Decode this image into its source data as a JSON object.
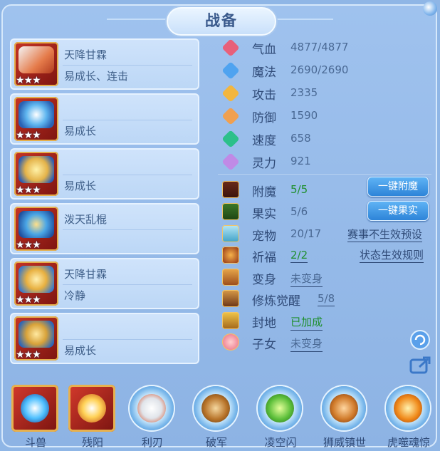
{
  "title": "战备",
  "equipment": [
    {
      "line1": "天降甘霖",
      "line2": "易成长、连击",
      "stars": "★★★"
    },
    {
      "line1": "",
      "line2": "易成长",
      "stars": "★★★"
    },
    {
      "line1": "",
      "line2": "易成长",
      "stars": "★★★"
    },
    {
      "line1": "泼天乱棍",
      "line2": "",
      "stars": "★★★"
    },
    {
      "line1": "天降甘霖",
      "line2": "冷静",
      "stars": "★★★"
    },
    {
      "line1": "",
      "line2": "易成长",
      "stars": "★★★"
    }
  ],
  "attributes": [
    {
      "name": "气血",
      "value": "4877/4877",
      "icon": "heart-icon",
      "color": "#e8607a"
    },
    {
      "name": "魔法",
      "value": "2690/2690",
      "icon": "magic-icon",
      "color": "#4fa3f0"
    },
    {
      "name": "攻击",
      "value": "2335",
      "icon": "sword-icon",
      "color": "#f2b640"
    },
    {
      "name": "防御",
      "value": "1590",
      "icon": "shield-icon",
      "color": "#f0a050"
    },
    {
      "name": "速度",
      "value": "658",
      "icon": "speed-icon",
      "color": "#2cc08a"
    },
    {
      "name": "灵力",
      "value": "921",
      "icon": "spirit-icon",
      "color": "#c08ae6"
    }
  ],
  "status": {
    "fumo": {
      "name": "附魔",
      "value": "5/5"
    },
    "guoshi": {
      "name": "果实",
      "value": "5/6"
    },
    "pet": {
      "name": "宠物",
      "value": "20/17"
    },
    "qifu": {
      "name": "祈福",
      "value": "2/2"
    },
    "bianshen": {
      "name": "变身",
      "value": "未变身"
    },
    "xiulian": {
      "name": "修炼觉醒",
      "value": "5/8"
    },
    "fengdi": {
      "name": "封地",
      "value": "已加成"
    },
    "zinv": {
      "name": "子女",
      "value": "未变身"
    }
  },
  "buttons": {
    "fumo": "一键附魔",
    "guoshi": "一键果实"
  },
  "links": {
    "preset": "赛事不生效预设",
    "rule": "状态生效规则"
  },
  "skills": [
    {
      "label": "斗兽",
      "style": "square",
      "color": "#4fc0ff"
    },
    {
      "label": "残阳",
      "style": "square",
      "color": "#ffd257"
    },
    {
      "label": "利刃",
      "style": "round",
      "color": "#e0e4ea"
    },
    {
      "label": "破军",
      "style": "round",
      "color": "#b8742a"
    },
    {
      "label": "凌空闪",
      "style": "round",
      "color": "#5cbf3a"
    },
    {
      "label": "狮威镇世",
      "style": "round",
      "color": "#d07a2a"
    },
    {
      "label": "虎噬魂惊",
      "style": "round",
      "color": "#f08a1a"
    }
  ],
  "accent": "#2d84d8"
}
